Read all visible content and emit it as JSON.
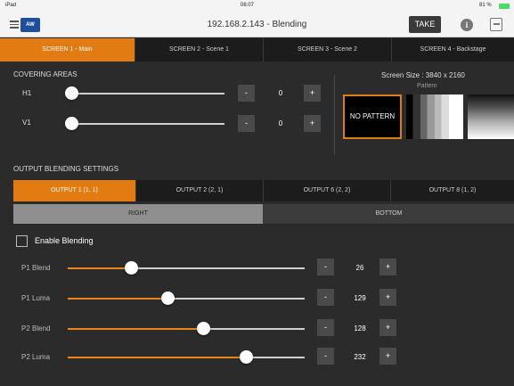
{
  "status_bar": {
    "device": "iPad",
    "time": "06:07",
    "battery": "81 %"
  },
  "nav": {
    "title": "192.168.2.143 - Blending",
    "logo_text": "AW",
    "take_label": "TAKE",
    "info_label": "i"
  },
  "screen_tabs": [
    {
      "label": "SCREEN 1 - Main",
      "active": true
    },
    {
      "label": "SCREEN 2 - Scene 1",
      "active": false
    },
    {
      "label": "SCREEN 3 - Scene 2",
      "active": false
    },
    {
      "label": "SCREEN 4 - Backstage",
      "active": false
    }
  ],
  "covering": {
    "heading": "COVERING AREAS",
    "h1": {
      "label": "H1",
      "value": "0",
      "minus": "-",
      "plus": "+",
      "level": 0
    },
    "v1": {
      "label": "V1",
      "value": "0",
      "minus": "-",
      "plus": "+",
      "level": 0
    }
  },
  "screen_info": {
    "screen_size": "Screen Size : 3840 x 2160",
    "pattern_label": "Pattern",
    "no_pattern": "NO PATTERN"
  },
  "output": {
    "heading": "OUTPUT BLENDING SETTINGS",
    "tabs": [
      {
        "label": "OUTPUT 1 (1, 1)",
        "active": true
      },
      {
        "label": "OUTPUT 2 (2, 1)",
        "active": false
      },
      {
        "label": "OUTPUT 6 (2, 2)",
        "active": false
      },
      {
        "label": "OUTPUT 8 (1, 2)",
        "active": false
      }
    ],
    "sides": [
      {
        "label": "RIGHT",
        "active": true
      },
      {
        "label": "BOTTOM",
        "active": false
      }
    ]
  },
  "blending": {
    "enable_label": "Enable Blending",
    "enabled": false,
    "rows": [
      {
        "label": "P1 Blend",
        "value": "26",
        "level": 0.266,
        "minus": "-",
        "plus": "+"
      },
      {
        "label": "P1 Luma",
        "value": "129",
        "level": 0.42,
        "minus": "-",
        "plus": "+"
      },
      {
        "label": "P2 Blend",
        "value": "128",
        "level": 0.57,
        "minus": "-",
        "plus": "+"
      },
      {
        "label": "P2 Luma",
        "value": "232",
        "level": 0.75,
        "minus": "-",
        "plus": "+"
      }
    ]
  },
  "colors": {
    "accent": "#e37b13",
    "background": "#2b2b2b",
    "tab_inactive": "#1c1c1c"
  }
}
